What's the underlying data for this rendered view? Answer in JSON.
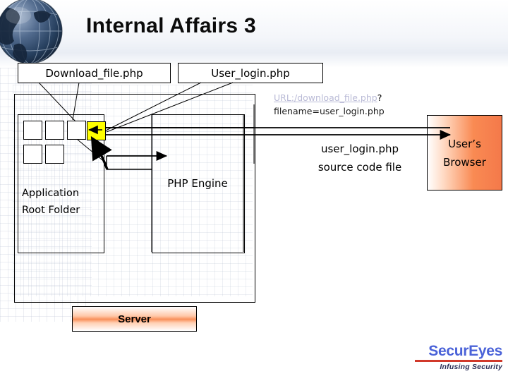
{
  "slide": {
    "title": "Internal Affairs 3"
  },
  "callouts": {
    "download_file": "Download_file.php",
    "user_login": "User_login.php"
  },
  "diagram": {
    "app_root_label": "Application\nRoot Folder",
    "app_root_line1": "Application",
    "app_root_line2": "Root Folder",
    "php_engine_label": "PHP Engine",
    "server_label": "Server",
    "browser_label_line1": "User’s",
    "browser_label_line2": "Browser"
  },
  "annotations": {
    "request_url_link": "URL:/download_file.php",
    "request_url_query_mark": "?",
    "request_param": "filename=user_login.php",
    "response_line1": "user_login.php",
    "response_line2": "source code file"
  },
  "files": [
    {
      "name": "file-tile-1",
      "highlighted": false
    },
    {
      "name": "file-tile-2",
      "highlighted": false
    },
    {
      "name": "file-tile-3",
      "highlighted": false
    },
    {
      "name": "file-tile-4-target",
      "highlighted": true
    },
    {
      "name": "file-tile-5",
      "highlighted": false
    },
    {
      "name": "file-tile-6",
      "highlighted": false
    }
  ],
  "logo": {
    "name": "SecurEyes",
    "tagline": "Infusing Security"
  },
  "colors": {
    "highlight_file": "#ffff00",
    "server_accent": "#f98f5a",
    "browser_accent": "#f4794a",
    "logo_blue": "#4a62d8",
    "logo_red": "#d1392b",
    "url_link": "#b9bad6"
  }
}
